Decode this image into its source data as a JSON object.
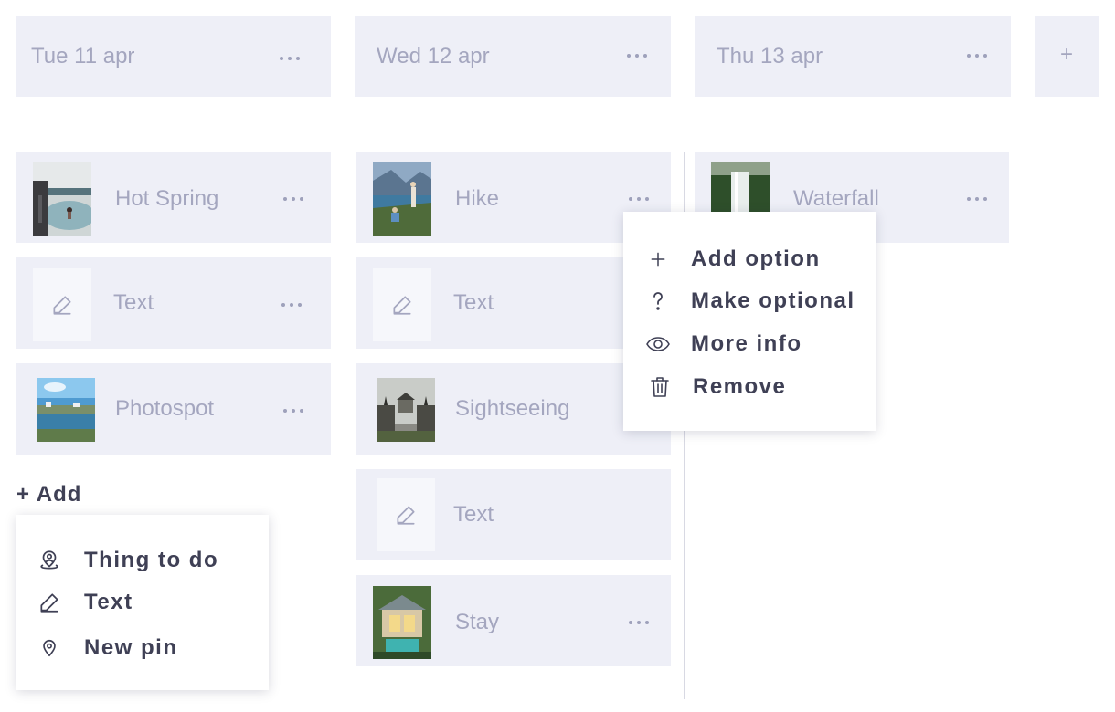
{
  "days": [
    {
      "title": "Tue 11 apr"
    },
    {
      "title": "Wed 12 apr"
    },
    {
      "title": "Thu 13 apr"
    }
  ],
  "add_day_label": "+",
  "columns": {
    "tue": {
      "items": [
        {
          "label": "Hot Spring",
          "icon": "hot-spring-photo"
        },
        {
          "label": "Text",
          "icon": "pencil-icon"
        },
        {
          "label": "Photospot",
          "icon": "photospot-photo"
        }
      ],
      "add_label": "+ Add"
    },
    "wed": {
      "items": [
        {
          "label": "Hike",
          "icon": "hike-photo"
        },
        {
          "label": "Text",
          "icon": "pencil-icon"
        },
        {
          "label": "Sightseeing",
          "icon": "sightseeing-photo"
        },
        {
          "label": "Text",
          "icon": "pencil-icon"
        },
        {
          "label": "Stay",
          "icon": "stay-photo"
        }
      ]
    },
    "thu": {
      "items": [
        {
          "label": "Waterfall",
          "icon": "waterfall-photo"
        }
      ]
    }
  },
  "add_menu": {
    "items": [
      {
        "label": "Thing to do",
        "icon": "map-user-icon"
      },
      {
        "label": "Text",
        "icon": "pencil-icon"
      },
      {
        "label": "New pin",
        "icon": "pin-icon"
      }
    ]
  },
  "context_menu": {
    "items": [
      {
        "label": "Add option",
        "icon": "plus-icon"
      },
      {
        "label": "Make optional",
        "icon": "question-icon"
      },
      {
        "label": "More info",
        "icon": "eye-icon"
      },
      {
        "label": "Remove",
        "icon": "trash-icon"
      }
    ]
  },
  "colors": {
    "card_bg": "#eeeff7",
    "muted_text": "#a4a6bf",
    "dark_text": "#3f4055"
  }
}
